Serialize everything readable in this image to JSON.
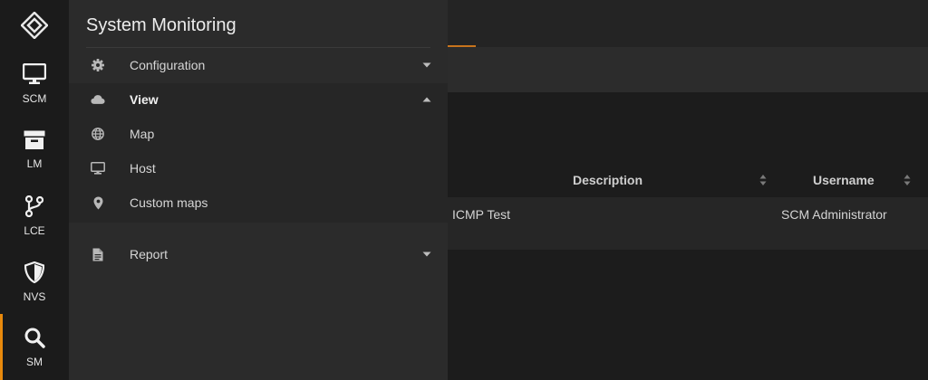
{
  "rail": {
    "items": [
      {
        "label": "SCM",
        "icon": "monitor-icon"
      },
      {
        "label": "LM",
        "icon": "archive-box-icon"
      },
      {
        "label": "LCE",
        "icon": "git-branch-icon"
      },
      {
        "label": "NVS",
        "icon": "shield-icon"
      },
      {
        "label": "SM",
        "icon": "search-icon",
        "active": true
      }
    ]
  },
  "panel": {
    "title": "System Monitoring",
    "menu": [
      {
        "label": "Configuration",
        "icon": "gear-icon",
        "expanded": false
      },
      {
        "label": "View",
        "icon": "cloud-icon",
        "expanded": true,
        "children": [
          {
            "label": "Map",
            "icon": "globe-icon"
          },
          {
            "label": "Host",
            "icon": "monitor-icon"
          },
          {
            "label": "Custom maps",
            "icon": "map-pin-icon"
          }
        ]
      },
      {
        "label": "Report",
        "icon": "document-icon",
        "expanded": false
      }
    ]
  },
  "table": {
    "columns": [
      "Description",
      "Username"
    ],
    "rows": [
      {
        "description": "ICMP Test",
        "username": "SCM Administrator"
      }
    ]
  },
  "colors": {
    "accent": "#e8890c",
    "rail_bg": "#1b1b1b",
    "panel_bg": "#2b2b2b",
    "main_bg": "#1c1c1c"
  }
}
